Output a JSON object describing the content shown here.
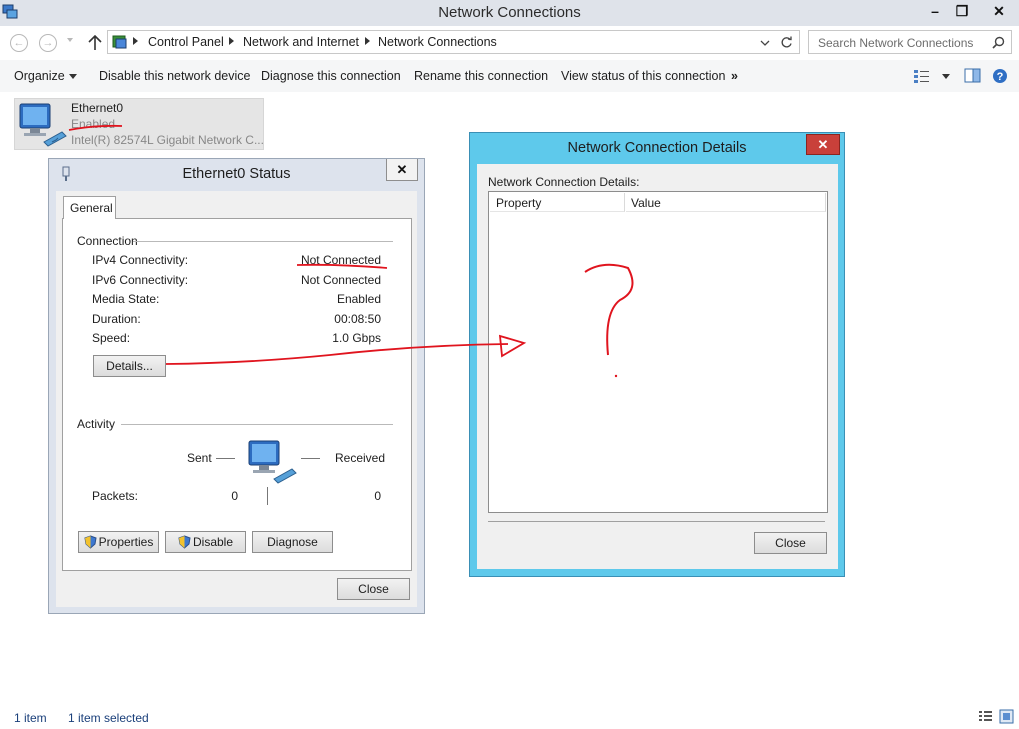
{
  "window": {
    "title": "Network Connections",
    "minimize": "–",
    "restore": "❐",
    "close": "✕"
  },
  "address": {
    "crumbs": [
      "Control Panel",
      "Network and Internet",
      "Network Connections"
    ],
    "search_placeholder": "Search Network Connections"
  },
  "commands": {
    "organize": "Organize",
    "disable_device": "Disable this network device",
    "diagnose": "Diagnose this connection",
    "rename": "Rename this connection",
    "view_status": "View status of this connection",
    "more": "»"
  },
  "connection": {
    "name": "Ethernet0",
    "status": "Enabled",
    "device": "Intel(R) 82574L Gigabit Network C..."
  },
  "status_dialog": {
    "title": "Ethernet0 Status",
    "close_x": "✕",
    "tab": "General",
    "connection_section": "Connection",
    "rows": [
      {
        "label": "IPv4 Connectivity:",
        "value": "Not Connected"
      },
      {
        "label": "IPv6 Connectivity:",
        "value": "Not Connected"
      },
      {
        "label": "Media State:",
        "value": "Enabled"
      },
      {
        "label": "Duration:",
        "value": "00:08:50"
      },
      {
        "label": "Speed:",
        "value": "1.0 Gbps"
      }
    ],
    "details_button": "Details...",
    "activity_section": "Activity",
    "sent_label": "Sent",
    "received_label": "Received",
    "packets_label": "Packets:",
    "packets_sent": "0",
    "packets_received": "0",
    "properties_button": "Properties",
    "disable_button": "Disable",
    "diagnose_button": "Diagnose",
    "close_button": "Close"
  },
  "details_dialog": {
    "title": "Network Connection Details",
    "close_x": "✕",
    "label": "Network Connection Details:",
    "col_property": "Property",
    "col_value": "Value",
    "close_button": "Close"
  },
  "statusbar": {
    "items": "1 item",
    "selected": "1 item selected"
  },
  "colors": {
    "details_title_bg": "#5ec9eb",
    "status_frame_bg": "#dde3ed",
    "annotation_red": "#e0141e",
    "close_btn_red": "#c9403a"
  }
}
